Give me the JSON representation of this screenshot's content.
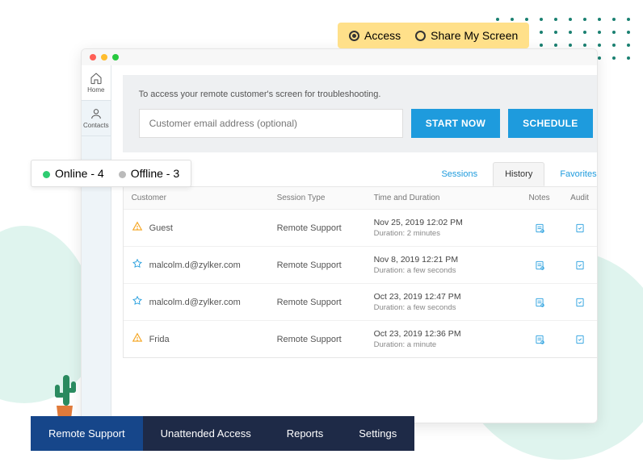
{
  "mode": {
    "access": "Access",
    "share": "Share My Screen"
  },
  "status": {
    "online": "Online - 4",
    "offline": "Offline - 3"
  },
  "sidebar": {
    "home": "Home",
    "contacts": "Contacts"
  },
  "hero": {
    "text": "To access your remote customer's screen for troubleshooting.",
    "placeholder": "Customer email address (optional)",
    "start": "START NOW",
    "schedule": "SCHEDULE"
  },
  "tabs": {
    "sessions": "Sessions",
    "history": "History",
    "favorites": "Favorites"
  },
  "table": {
    "headers": {
      "customer": "Customer",
      "type": "Session Type",
      "time": "Time and Duration",
      "notes": "Notes",
      "audit": "Audit"
    },
    "rows": [
      {
        "icon": "guest",
        "customer": "Guest",
        "type": "Remote Support",
        "time": "Nov 25, 2019 12:02 PM",
        "duration": "Duration: 2 minutes"
      },
      {
        "icon": "star",
        "customer": "malcolm.d@zylker.com",
        "type": "Remote Support",
        "time": "Nov 8, 2019 12:21 PM",
        "duration": "Duration: a few seconds"
      },
      {
        "icon": "star",
        "customer": "malcolm.d@zylker.com",
        "type": "Remote Support",
        "time": "Oct 23, 2019 12:47 PM",
        "duration": "Duration: a few seconds"
      },
      {
        "icon": "guest",
        "customer": "Frida",
        "type": "Remote Support",
        "time": "Oct 23, 2019 12:36 PM",
        "duration": "Duration: a minute"
      }
    ]
  },
  "bottomNav": {
    "remote": "Remote Support",
    "unattended": "Unattended Access",
    "reports": "Reports",
    "settings": "Settings"
  }
}
